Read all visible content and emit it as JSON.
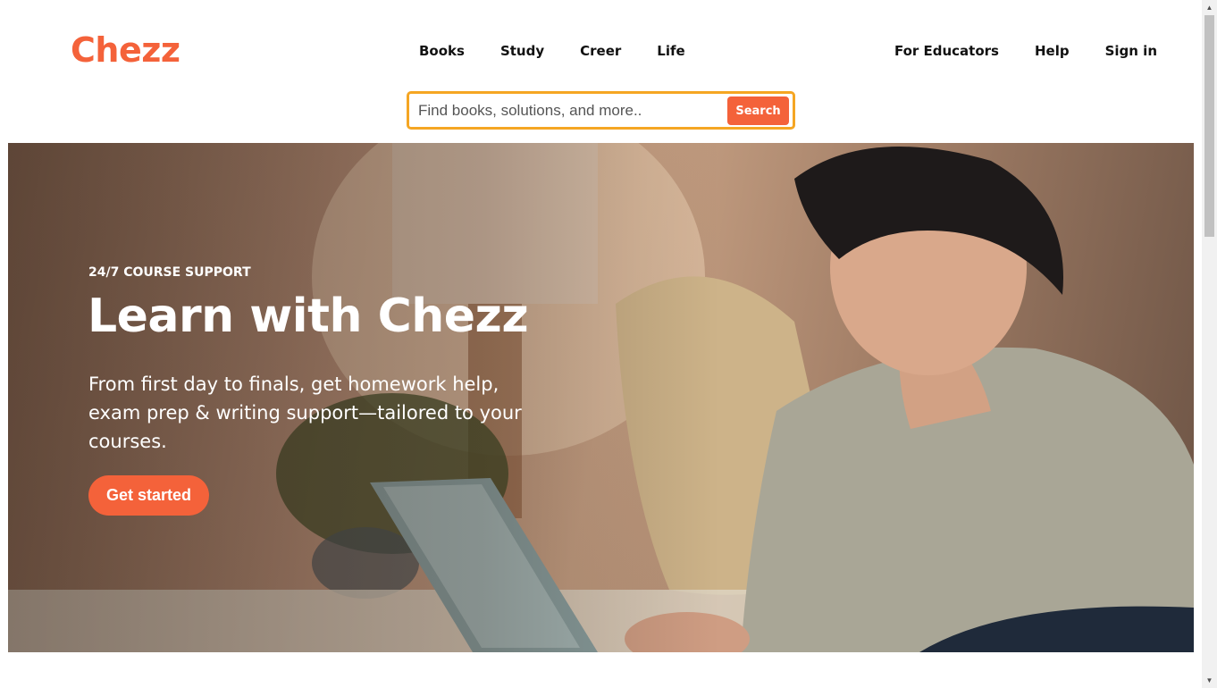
{
  "brand": {
    "name": "Chezz",
    "accent": "#f4623a",
    "search_border": "#f5a623"
  },
  "nav": {
    "main": [
      "Books",
      "Study",
      "Creer",
      "Life"
    ],
    "right": [
      "For Educators",
      "Help",
      "Sign in"
    ]
  },
  "search": {
    "placeholder": "Find books, solutions, and more..",
    "button_label": "Search"
  },
  "hero": {
    "eyebrow": "24/7 COURSE SUPPORT",
    "headline": "Learn with Chezz",
    "subtext": "From first day to finals, get homework help, exam prep & writing support—tailored to your courses.",
    "cta_label": "Get started"
  },
  "scrollbar": {
    "up_icon": "▲",
    "down_icon": "▼"
  }
}
